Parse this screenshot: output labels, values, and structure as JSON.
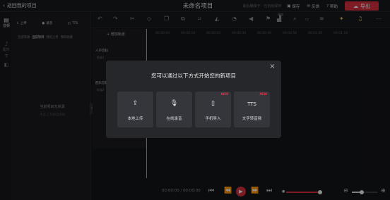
{
  "topbar": {
    "back_label": "返回我的项目",
    "title": "未命名项目",
    "note": "最后编辑于 · 已自动保存",
    "save_label": "保存",
    "feedback_label": "反馈",
    "help_label": "帮助",
    "export_label": "导出"
  },
  "leftnav": {
    "items": [
      {
        "label": "音频",
        "icon": "folder-icon"
      },
      {
        "label": "配乐",
        "icon": "music-note-icon"
      },
      {
        "label": "",
        "icon": "text-icon"
      },
      {
        "label": "",
        "icon": "sticker-icon"
      }
    ]
  },
  "media_panel": {
    "tools": [
      {
        "label": "上传",
        "icon": "upload-icon"
      },
      {
        "label": "录音",
        "icon": "mic-icon"
      },
      {
        "label": "TTS",
        "icon": "tts-icon"
      }
    ],
    "tabs": [
      "全部资源",
      "当前项目",
      "我的上传",
      "我的收藏"
    ],
    "active_tab": "当前项目",
    "empty_text": "当前项目无资源",
    "empty_hint": "点击上方按钮添加"
  },
  "timeline": {
    "add_track_label": "增加轨道",
    "zoom_label": "缩放",
    "tracks": [
      {
        "name": "人声音轨",
        "sub": "轨道1"
      },
      {
        "name": "配乐音轨",
        "sub": "轨道2"
      }
    ],
    "ruler_ticks": [
      "00:00:00",
      "00:00:10",
      "00:00:20",
      "00:00:30",
      "00:00:40",
      "00:00:50",
      "00:01:00",
      "00:01:10"
    ]
  },
  "player": {
    "current_time": "00:00:00",
    "total_time": "00:00:00",
    "separator": "/",
    "volume": 0.9,
    "zoom": 0.35
  },
  "modal": {
    "title": "您可以通过以下方式开始您的新项目",
    "options": [
      {
        "label": "本地上传",
        "icon": "upload-icon",
        "badge": ""
      },
      {
        "label": "在线录音",
        "icon": "mic-icon",
        "badge": ""
      },
      {
        "label": "手机导入",
        "icon": "phone-import-icon",
        "badge": "NEW"
      },
      {
        "label": "文字转音频",
        "icon": "tts-text-icon",
        "badge": "NEW",
        "icon_text": "TTS"
      }
    ]
  },
  "colors": {
    "accent": "#d7313f",
    "background": "#141518",
    "modal_bg": "#26272b",
    "card_bg": "#35363b"
  }
}
